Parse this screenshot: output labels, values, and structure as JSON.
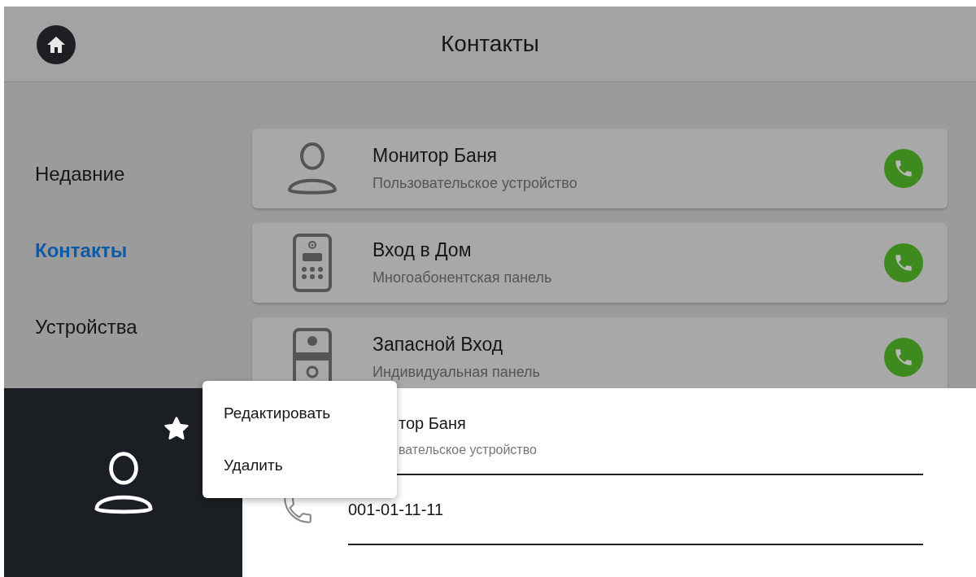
{
  "header": {
    "title": "Контакты"
  },
  "sidebar": {
    "items": [
      {
        "label": "Недавние",
        "selected": false
      },
      {
        "label": "Контакты",
        "selected": true
      },
      {
        "label": "Устройства",
        "selected": false
      }
    ]
  },
  "contacts": [
    {
      "name": "Монитор Баня",
      "type": "Пользовательское устройство",
      "kind": "user"
    },
    {
      "name": "Вход в Дом",
      "type": "Многоабонентская панель",
      "kind": "multi"
    },
    {
      "name": "Запасной Вход",
      "type": "Индивидуальная панель",
      "kind": "single"
    }
  ],
  "detail": {
    "favorite": true,
    "kind": "user",
    "name": "тор Баня",
    "type": "вательское устройство",
    "phone": "001-01-11-11"
  },
  "menu": {
    "items": [
      "Редактировать",
      "Удалить"
    ]
  }
}
